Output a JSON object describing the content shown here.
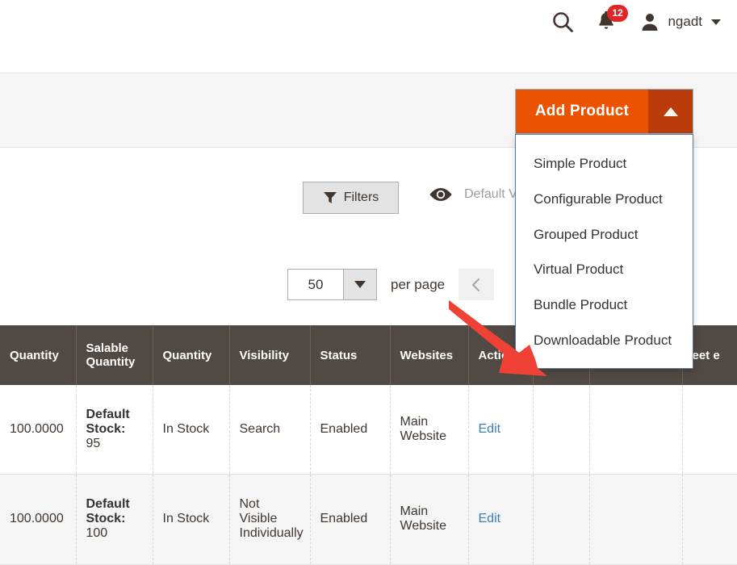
{
  "header": {
    "search_icon": "search-icon",
    "notifications": {
      "icon": "bell-icon",
      "count": "12"
    },
    "user": {
      "avatar_icon": "user-avatar-icon",
      "name": "ngadt",
      "caret_icon": "chevron-down-icon"
    }
  },
  "add_product": {
    "label": "Add Product",
    "toggle_icon": "chevron-up-icon",
    "expanded": true,
    "menu_items": [
      {
        "label": "Simple Product"
      },
      {
        "label": "Configurable Product"
      },
      {
        "label": "Grouped Product"
      },
      {
        "label": "Virtual Product"
      },
      {
        "label": "Bundle Product"
      },
      {
        "label": "Downloadable Product"
      }
    ]
  },
  "toolbar": {
    "filters_label": "Filters",
    "filters_icon": "funnel-icon",
    "view_icon": "eye-icon",
    "view_label": "Default View"
  },
  "pager": {
    "per_page_value": "50",
    "per_page_caret_icon": "chevron-down-icon",
    "per_page_label": "per page",
    "prev_icon": "chevron-left-icon"
  },
  "grid": {
    "columns": [
      "Quantity",
      "Salable Quantity",
      "Quantity",
      "Visibility",
      "Status",
      "Websites",
      "Action",
      "",
      "",
      "eet e"
    ],
    "rows": [
      {
        "quantity": "100.0000",
        "salable_stock_label": "Default Stock",
        "salable_stock_sep": ":",
        "salable_stock_value": "95",
        "quantity2": "In Stock",
        "visibility": "Search",
        "status": "Enabled",
        "websites": "Main Website",
        "action": "Edit",
        "extra1": "",
        "extra2": "",
        "extra3": ""
      },
      {
        "quantity": "100.0000",
        "salable_stock_label": "Default Stock",
        "salable_stock_sep": ":",
        "salable_stock_value": "100",
        "quantity2": "In Stock",
        "visibility": "Not Visible Individually",
        "status": "Enabled",
        "websites": "Main Website",
        "action": "Edit",
        "extra1": "",
        "extra2": "",
        "extra3": ""
      }
    ]
  },
  "annotation": {
    "arrow_color": "#ef4136",
    "points_to": "Downloadable Product"
  },
  "colors": {
    "brand_orange": "#eb5202",
    "brand_orange_dark": "#ba3c0a",
    "header_dark": "#514943",
    "link_blue": "#3b7eb8",
    "badge_red": "#e22626"
  }
}
